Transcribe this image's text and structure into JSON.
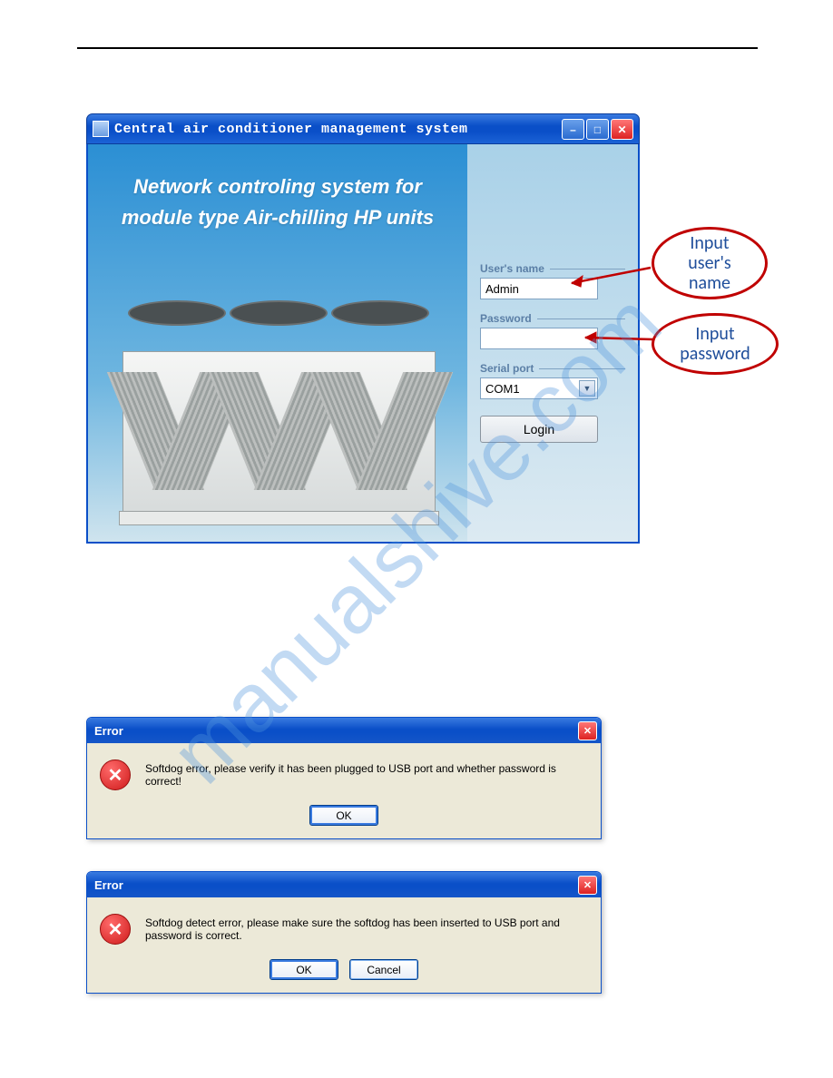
{
  "watermark": "manualshive.com",
  "login_window": {
    "title": "Central air conditioner management system",
    "heading_line1": "Network controling system for",
    "heading_line2": "module type Air-chilling HP units",
    "username_label": "User's name",
    "username_value": "Admin",
    "password_label": "Password",
    "password_value": "",
    "serialport_label": "Serial port",
    "serialport_value": "COM1",
    "login_button": "Login"
  },
  "callouts": {
    "username": "Input\nuser's\nname",
    "password": "Input\npassword"
  },
  "error1": {
    "title": "Error",
    "message": "Softdog error, please verify it has been plugged to USB port and whether password is correct!",
    "ok": "OK"
  },
  "error2": {
    "title": "Error",
    "message": "Softdog detect error, please make sure the softdog has been inserted to USB port and password is correct.",
    "ok": "OK",
    "cancel": "Cancel"
  }
}
